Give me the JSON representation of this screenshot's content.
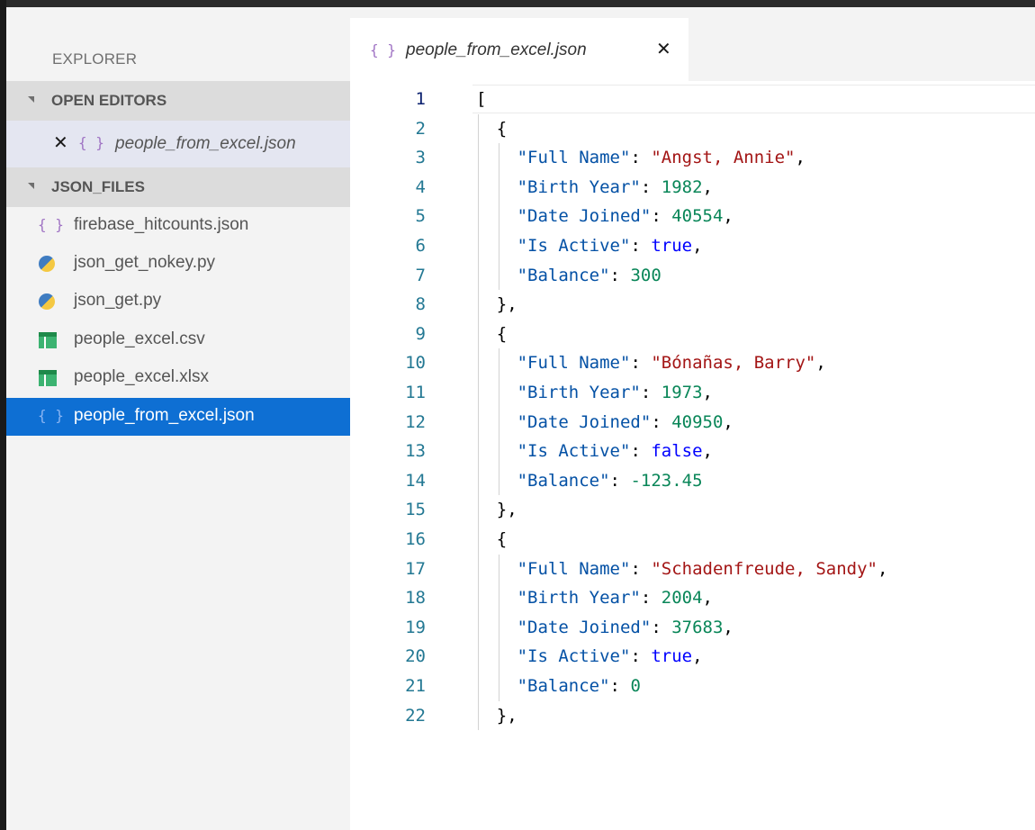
{
  "sidebar": {
    "title": "EXPLORER",
    "open_editors_label": "OPEN EDITORS",
    "open_editor": {
      "close": "✕",
      "icon": "json-braces",
      "braces": "{ }",
      "name": "people_from_excel.json"
    },
    "folder_label": "JSON_FILES",
    "files": [
      {
        "name": "firebase_hitcounts.json",
        "icon": "json-braces",
        "glyph": "{ }"
      },
      {
        "name": "json_get_nokey.py",
        "icon": "python-icon"
      },
      {
        "name": "json_get.py",
        "icon": "python-icon"
      },
      {
        "name": "people_excel.csv",
        "icon": "spreadsheet-icon"
      },
      {
        "name": "people_excel.xlsx",
        "icon": "spreadsheet-icon"
      },
      {
        "name": "people_from_excel.json",
        "icon": "json-braces",
        "glyph": "{ }",
        "selected": true
      }
    ]
  },
  "tab": {
    "braces": "{ }",
    "title": "people_from_excel.json",
    "close": "✕"
  },
  "editor": {
    "lines": [
      {
        "n": "1",
        "tokens": [
          [
            "p",
            "["
          ]
        ]
      },
      {
        "n": "2",
        "tokens": [
          [
            "p",
            "{"
          ]
        ]
      },
      {
        "n": "3",
        "tokens": [
          [
            "k",
            "\"Full Name\""
          ],
          [
            "p",
            ": "
          ],
          [
            "s",
            "\"Angst, Annie\""
          ],
          [
            "p",
            ","
          ]
        ]
      },
      {
        "n": "4",
        "tokens": [
          [
            "k",
            "\"Birth Year\""
          ],
          [
            "p",
            ": "
          ],
          [
            "n",
            "1982"
          ],
          [
            "p",
            ","
          ]
        ]
      },
      {
        "n": "5",
        "tokens": [
          [
            "k",
            "\"Date Joined\""
          ],
          [
            "p",
            ": "
          ],
          [
            "n",
            "40554"
          ],
          [
            "p",
            ","
          ]
        ]
      },
      {
        "n": "6",
        "tokens": [
          [
            "k",
            "\"Is Active\""
          ],
          [
            "p",
            ": "
          ],
          [
            "b",
            "true"
          ],
          [
            "p",
            ","
          ]
        ]
      },
      {
        "n": "7",
        "tokens": [
          [
            "k",
            "\"Balance\""
          ],
          [
            "p",
            ": "
          ],
          [
            "n",
            "300"
          ]
        ]
      },
      {
        "n": "8",
        "tokens": [
          [
            "p",
            "},"
          ]
        ]
      },
      {
        "n": "9",
        "tokens": [
          [
            "p",
            "{"
          ]
        ]
      },
      {
        "n": "10",
        "tokens": [
          [
            "k",
            "\"Full Name\""
          ],
          [
            "p",
            ": "
          ],
          [
            "s",
            "\"Bónañas, Barry\""
          ],
          [
            "p",
            ","
          ]
        ]
      },
      {
        "n": "11",
        "tokens": [
          [
            "k",
            "\"Birth Year\""
          ],
          [
            "p",
            ": "
          ],
          [
            "n",
            "1973"
          ],
          [
            "p",
            ","
          ]
        ]
      },
      {
        "n": "12",
        "tokens": [
          [
            "k",
            "\"Date Joined\""
          ],
          [
            "p",
            ": "
          ],
          [
            "n",
            "40950"
          ],
          [
            "p",
            ","
          ]
        ]
      },
      {
        "n": "13",
        "tokens": [
          [
            "k",
            "\"Is Active\""
          ],
          [
            "p",
            ": "
          ],
          [
            "b",
            "false"
          ],
          [
            "p",
            ","
          ]
        ]
      },
      {
        "n": "14",
        "tokens": [
          [
            "k",
            "\"Balance\""
          ],
          [
            "p",
            ": "
          ],
          [
            "n",
            "-123.45"
          ]
        ]
      },
      {
        "n": "15",
        "tokens": [
          [
            "p",
            "},"
          ]
        ]
      },
      {
        "n": "16",
        "tokens": [
          [
            "p",
            "{"
          ]
        ]
      },
      {
        "n": "17",
        "tokens": [
          [
            "k",
            "\"Full Name\""
          ],
          [
            "p",
            ": "
          ],
          [
            "s",
            "\"Schadenfreude, Sandy\""
          ],
          [
            "p",
            ","
          ]
        ]
      },
      {
        "n": "18",
        "tokens": [
          [
            "k",
            "\"Birth Year\""
          ],
          [
            "p",
            ": "
          ],
          [
            "n",
            "2004"
          ],
          [
            "p",
            ","
          ]
        ]
      },
      {
        "n": "19",
        "tokens": [
          [
            "k",
            "\"Date Joined\""
          ],
          [
            "p",
            ": "
          ],
          [
            "n",
            "37683"
          ],
          [
            "p",
            ","
          ]
        ]
      },
      {
        "n": "20",
        "tokens": [
          [
            "k",
            "\"Is Active\""
          ],
          [
            "p",
            ": "
          ],
          [
            "b",
            "true"
          ],
          [
            "p",
            ","
          ]
        ]
      },
      {
        "n": "21",
        "tokens": [
          [
            "k",
            "\"Balance\""
          ],
          [
            "p",
            ": "
          ],
          [
            "n",
            "0"
          ]
        ]
      },
      {
        "n": "22",
        "tokens": [
          [
            "p",
            "},"
          ]
        ]
      }
    ],
    "indents": [
      0,
      1,
      2,
      2,
      2,
      2,
      2,
      1,
      1,
      2,
      2,
      2,
      2,
      2,
      1,
      1,
      2,
      2,
      2,
      2,
      2,
      1
    ]
  }
}
